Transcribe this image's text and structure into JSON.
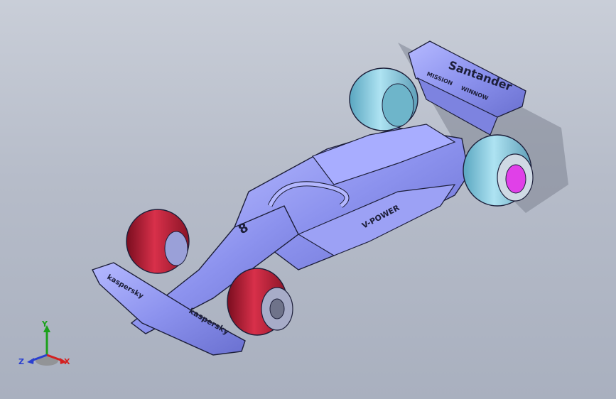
{
  "viewport": {
    "background_top": "#c9ced8",
    "background_bottom": "#a9b0bf"
  },
  "model": {
    "body_color": "#8f95f0",
    "edge_color": "#1d1f3a",
    "front_tire_color": "#c0203a",
    "rear_tire_color": "#8fd1e6",
    "rim_accent_color": "#e040e8",
    "decals": {
      "rear_wing_brand": "Santander",
      "rear_wing_sub1": "MISSION",
      "rear_wing_sub2": "WINNOW",
      "sidepod": "V-POWER",
      "front_wing_left": "kaspersky",
      "front_wing_right": "kaspersky",
      "car_number": "8"
    }
  },
  "triad": {
    "x_label": "X",
    "y_label": "Y",
    "z_label": "Z",
    "x_color": "#d42020",
    "y_color": "#1aa11a",
    "z_color": "#2a3fd0"
  }
}
